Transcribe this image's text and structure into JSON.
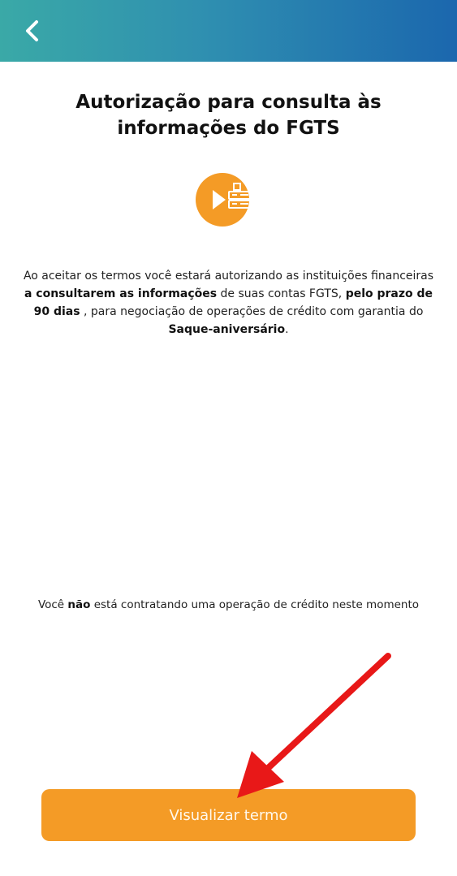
{
  "header": {
    "back_icon": "chevron-left-icon",
    "gradient_colors": [
      "#3aa9a7",
      "#1b67ae"
    ]
  },
  "title": {
    "line1": "Autorização para consulta às",
    "line2": "informações do FGTS"
  },
  "illustration": {
    "icon": "fgts-play-icon",
    "color": "#f49b26"
  },
  "description": {
    "part1": "Ao aceitar os termos você estará autorizando as instituições financeiras",
    "bold1": "a consultarem as informações",
    "part2": " de suas contas FGTS, ",
    "bold2": "pelo prazo de 90 dias",
    "part3": " , para negociação de operações de crédito com garantia do ",
    "bold3": "Saque-aniversário",
    "part4": "."
  },
  "notice": {
    "prefix": "Você ",
    "bold": "não",
    "suffix": " está contratando uma operação de crédito neste momento"
  },
  "cta": {
    "label": "Visualizar termo",
    "color": "#f49b26"
  },
  "annotation": {
    "arrow_color": "#e81818"
  }
}
